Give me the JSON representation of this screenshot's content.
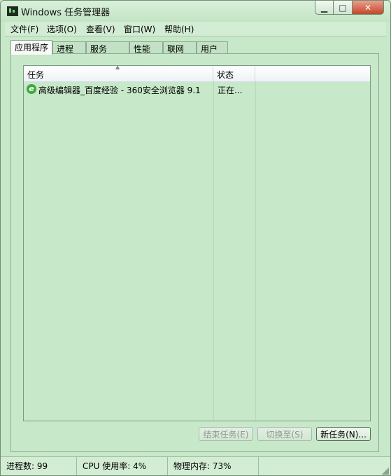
{
  "window": {
    "title": "Windows 任务管理器"
  },
  "menu": [
    "文件(F)",
    "选项(O)",
    "查看(V)",
    "窗口(W)",
    "帮助(H)"
  ],
  "tabs": [
    {
      "label": "应用程序",
      "active": true
    },
    {
      "label": "进程",
      "active": false
    },
    {
      "label": "服务",
      "active": false
    },
    {
      "label": "性能",
      "active": false
    },
    {
      "label": "联网",
      "active": false
    },
    {
      "label": "用户",
      "active": false
    }
  ],
  "list": {
    "columns": [
      "任务",
      "状态"
    ],
    "rows": [
      {
        "icon": "ie-browser-icon",
        "task": "高级编辑器_百度经验 - 360安全浏览器 9.1",
        "status": "正在..."
      }
    ]
  },
  "buttons": {
    "end_task": "结束任务(E)",
    "switch_to": "切换至(S)",
    "new_task": "新任务(N)..."
  },
  "statusbar": {
    "processes": "进程数: 99",
    "cpu": "CPU 使用率: 4%",
    "memory": "物理内存: 73%"
  },
  "colors": {
    "window_bg": "#c7e8c9",
    "close_button": "#c4462a"
  }
}
